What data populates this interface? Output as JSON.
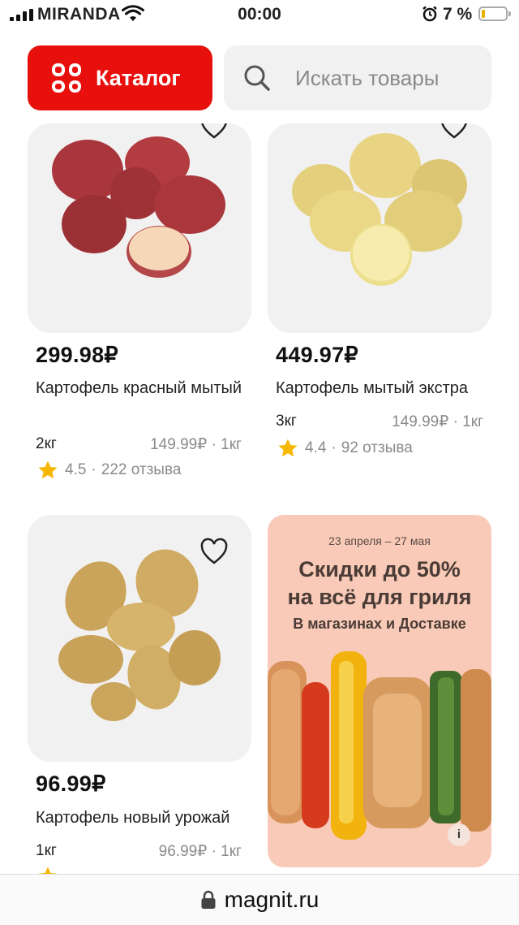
{
  "status_bar": {
    "carrier": "MIRANDA",
    "time": "00:00",
    "battery": "7 %",
    "battery_level": 0.07
  },
  "header": {
    "catalog_label": "Каталог",
    "search_placeholder": "Искать товары"
  },
  "products": [
    {
      "price": "299.98₽",
      "name": "Картофель красный мытый",
      "weight": "2кг",
      "unit_price": "149.99₽ · 1кг",
      "rating": "4.5",
      "reviews": "222 отзыва",
      "image": "red-potatoes-photo"
    },
    {
      "price": "449.97₽",
      "name": "Картофель мытый экстра",
      "weight": "3кг",
      "unit_price": "149.99₽ · 1кг",
      "rating": "4.4",
      "reviews": "92 отзыва",
      "image": "washed-potatoes-photo"
    },
    {
      "price": "96.99₽",
      "name": "Картофель новый урожай",
      "weight": "1кг",
      "unit_price": "96.99₽ · 1кг",
      "image": "new-potatoes-photo"
    }
  ],
  "promo": {
    "dates": "23 апреля – 27 мая",
    "headline_line1": "Скидки до 50%",
    "headline_line2": "на всё для гриля",
    "subtitle": "В магазинах и Доставке",
    "info": "i"
  },
  "url_bar": {
    "url": "magnit.ru"
  },
  "colors": {
    "brand_red": "#e8100c",
    "star": "#f5b700",
    "promo_bg": "#f8cab7"
  }
}
